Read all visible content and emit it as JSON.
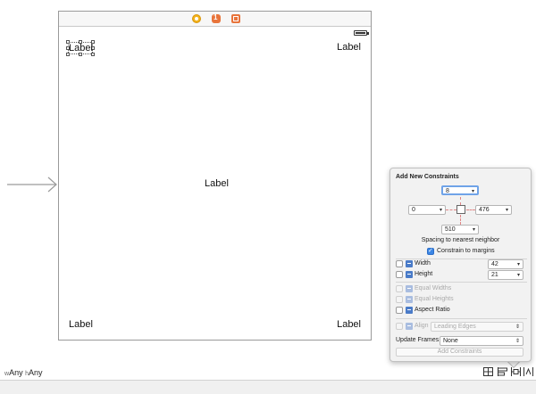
{
  "canvas": {
    "labels": {
      "top_left": "Label",
      "top_right": "Label",
      "center": "Label",
      "bottom_left": "Label",
      "bottom_right": "Label"
    }
  },
  "size_class": {
    "width_prefix": "w",
    "width_value": "Any",
    "height_prefix": "h",
    "height_value": "Any"
  },
  "constraints_popover": {
    "title": "Add New Constraints",
    "top_spacing": "8",
    "left_spacing": "0",
    "right_spacing": "476",
    "bottom_spacing": "510",
    "spacing_caption": "Spacing to nearest neighbor",
    "constrain_to_margins": {
      "label": "Constrain to margins",
      "checked": true
    },
    "width": {
      "label": "Width",
      "value": "42",
      "checked": false
    },
    "height": {
      "label": "Height",
      "value": "21",
      "checked": false
    },
    "equal_widths": {
      "label": "Equal Widths",
      "enabled": false
    },
    "equal_heights": {
      "label": "Equal Heights",
      "enabled": false
    },
    "aspect_ratio": {
      "label": "Aspect Ratio",
      "checked": false
    },
    "align": {
      "label": "Align",
      "value": "Leading Edges",
      "enabled": false
    },
    "update_frames": {
      "label": "Update Frames",
      "value": "None"
    },
    "add_button": "Add Constraints"
  },
  "colors": {
    "accent": "#3b86e5",
    "constraint_strut": "#e08585",
    "view_controller_icon": "#f2b21c",
    "scene_icon": "#e8743b"
  },
  "icons": [
    "view-controller-icon",
    "first-responder-icon",
    "exit-icon",
    "battery-icon",
    "stack-icon",
    "align-icon",
    "pin-icon",
    "resolve-icon",
    "entry-arrow-icon"
  ]
}
